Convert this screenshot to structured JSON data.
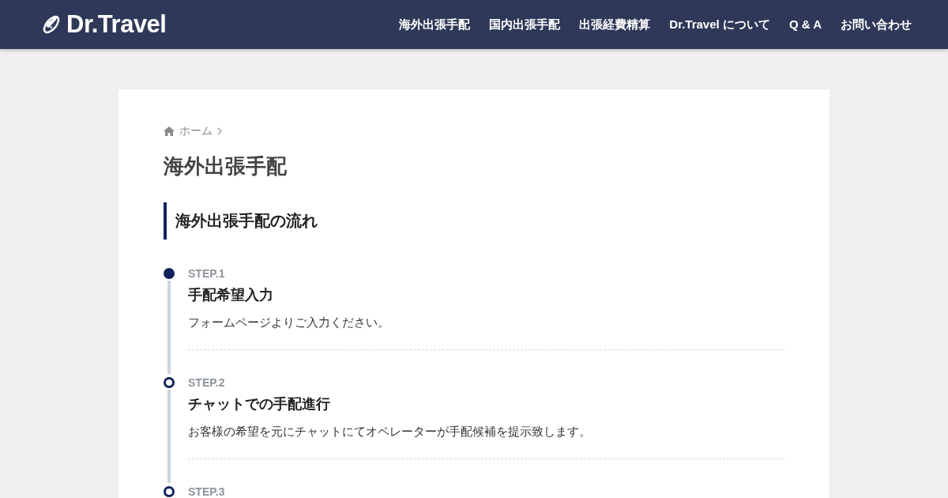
{
  "header": {
    "logo": "Dr.Travel",
    "nav": [
      {
        "label": "海外出張手配"
      },
      {
        "label": "国内出張手配"
      },
      {
        "label": "出張経費精算"
      },
      {
        "label": "Dr.Travel について"
      },
      {
        "label": "Q & A"
      },
      {
        "label": "お問い合わせ"
      }
    ]
  },
  "breadcrumb": {
    "items": [
      "ホーム"
    ]
  },
  "page_title": "海外出張手配",
  "section_title": "海外出張手配の流れ",
  "steps": [
    {
      "step": "STEP.1",
      "title": "手配希望入力",
      "description": "フォームページよりご入力ください。",
      "kind": "filled"
    },
    {
      "step": "STEP.2",
      "title": "チャットでの手配進行",
      "description": "お客様の希望を元にチャットにてオペレーターが手配候補を提示致します。",
      "kind": "outline"
    },
    {
      "step": "STEP.3",
      "kind": "outline"
    }
  ]
}
